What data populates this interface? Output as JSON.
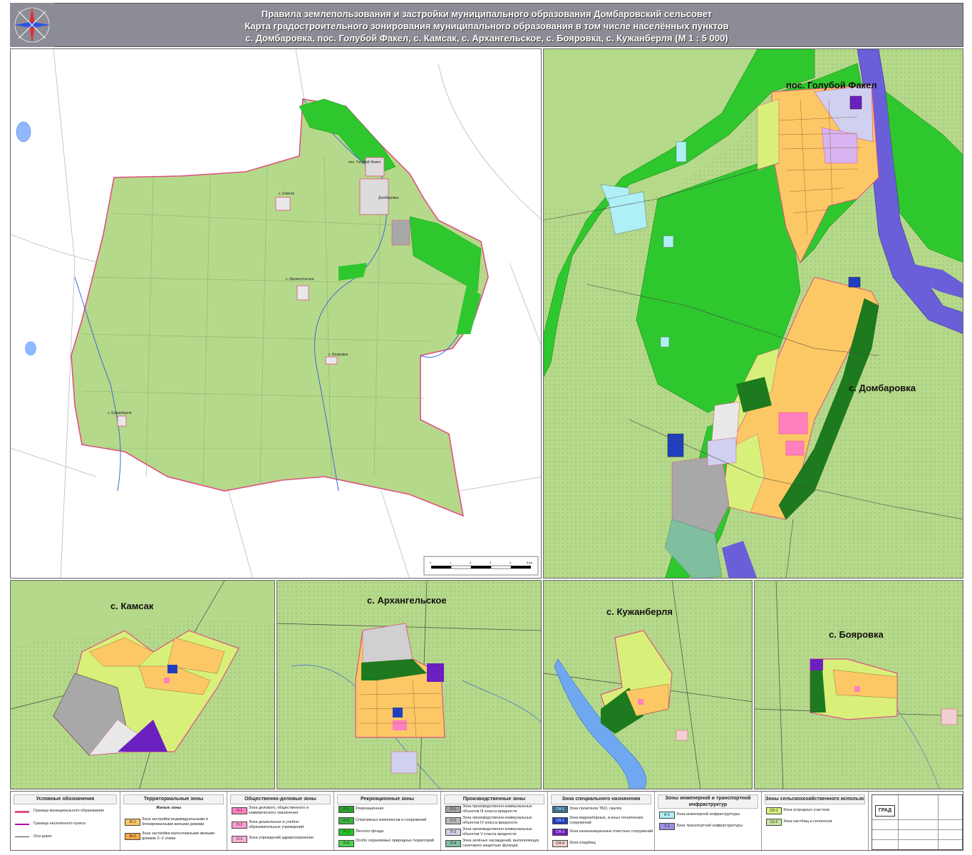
{
  "header": {
    "line1": "Правила землепользования и застройки муниципального образования Домбаровский сельсовет",
    "line2": "Карта градостроительного зонирования муниципального образования в том числе  населённых пунктов",
    "line3": "с. Домбаровка, пос. Голубой Факел, с. Камсак, с. Архангельское, с. Бояровка, с. Кужанберля (М 1 : 5 000)"
  },
  "panels": {
    "golubov": "пос. Голубой Факел",
    "dombarovka": "с. Домбаровка",
    "kamsak": "с. Камсак",
    "arkhangelskoe": "с. Архангельское",
    "kuzhanberlya": "с. Кужанберля",
    "boyarovka": "с. Бояровка"
  },
  "overview_labels": {
    "golubov": "пос. Голубой Факел",
    "dombarovka": "Домбаровка",
    "kamsak": "с. Камсак",
    "arkhangelskoe": "с. Архангельское",
    "boyarovka": "с. Бояровка",
    "kuzhanberlya": "с. Кужанберля"
  },
  "scale_bar": {
    "ticks": [
      "0",
      "1",
      "2",
      "3",
      "4",
      "5 км"
    ]
  },
  "legend": {
    "conventions": {
      "title": "Условные обозначения",
      "items": [
        "Граница муниципального образования",
        "Граница населённого пункта",
        "Оси дорог"
      ]
    },
    "territorial": {
      "title": "Территориальные зоны",
      "subtitle": "Жилые зоны",
      "items": [
        {
          "code": "Ж-1",
          "text": "Зона застройки индивидуальными и блокированными жилыми домами",
          "color": "#fcc865"
        },
        {
          "code": "Ж-2",
          "text": "Зона застройки малоэтажными жилыми домами 2–3 этажа",
          "color": "#f7a64a"
        }
      ]
    },
    "public": {
      "title": "Общественно-деловые зоны",
      "items": [
        {
          "code": "О-1",
          "text": "Зона делового, общественного и коммерческого назначения",
          "color": "#ff7fbf"
        },
        {
          "code": "О-2",
          "text": "Зона дошкольных и учебно-образовательных учреждений",
          "color": "#ff9fd0"
        },
        {
          "code": "О-3",
          "text": "Зона учреждений здравоохранения",
          "color": "#ffb0d8"
        }
      ]
    },
    "recreation": {
      "title": "Рекреационные зоны",
      "items": [
        {
          "code": "Р-1",
          "text": "Рекреационная",
          "color": "#2ca02c"
        },
        {
          "code": "Р-2",
          "text": "Спортивных комплексов и сооружений",
          "color": "#3cb043"
        },
        {
          "code": "Р-3",
          "text": "Лесного фонда",
          "color": "#22c422"
        },
        {
          "code": "Р-4",
          "text": "Особо охраняемых природных территорий",
          "color": "#4fd04f"
        }
      ]
    },
    "production": {
      "title": "Производственные зоны",
      "items": [
        {
          "code": "П-1",
          "text": "Зона производственно-коммунальных объектов III класса вредности",
          "color": "#a0a0a0"
        },
        {
          "code": "П-2",
          "text": "Зона производственно-коммунальных объектов IV класса вредности",
          "color": "#b8b8b8"
        },
        {
          "code": "П-3",
          "text": "Зона производственно-коммунальных объектов V класса вредности",
          "color": "#d0d0e8"
        },
        {
          "code": "П-4",
          "text": "Зона зелёных насаждений, выполняющих санитарно-защитные функции",
          "color": "#7fbfa0"
        }
      ]
    },
    "special": {
      "title": "Зона специального назначения",
      "items": [
        {
          "code": "СН-1",
          "text": "Зона полигонов ТБО, свалок",
          "color": "#3a6f8f"
        },
        {
          "code": "СН-2",
          "text": "Зона водозаборных, и иных технических сооружений",
          "color": "#1f3fbf"
        },
        {
          "code": "СН-3",
          "text": "Зона канализационных очистных сооружений",
          "color": "#6a1fbf"
        },
        {
          "code": "СН-4",
          "text": "Зона кладбищ",
          "color": "#f0d0d0"
        }
      ]
    },
    "infrastructure": {
      "title": "Зоны инженерной и транспортной инфраструктур",
      "items": [
        {
          "code": "И-1",
          "text": "Зона инженерной инфраструктуры",
          "color": "#aef0f5"
        },
        {
          "code": "Т-1",
          "text": "Зона транспортной инфраструктуры",
          "color": "#9b8fe0"
        }
      ]
    },
    "agricultural": {
      "title": "Зоны сельскохозяйственного использования",
      "items": [
        {
          "code": "СХ-1",
          "text": "Зона огородных  участков",
          "color": "#d8f07a"
        },
        {
          "code": "СХ-2",
          "text": "Зона пастбищ и сенокосов",
          "color": "#c8e6a0"
        }
      ]
    }
  },
  "stamp": {
    "org": "ГРАД"
  },
  "colors": {
    "header_bg": "#8c8c96",
    "agri": "#b5d98a",
    "forest": "#2ec82e",
    "residential": "#fcc865",
    "water": "#6a5fd8",
    "industrial": "#a8a8a8",
    "boundary": "#e05080"
  }
}
